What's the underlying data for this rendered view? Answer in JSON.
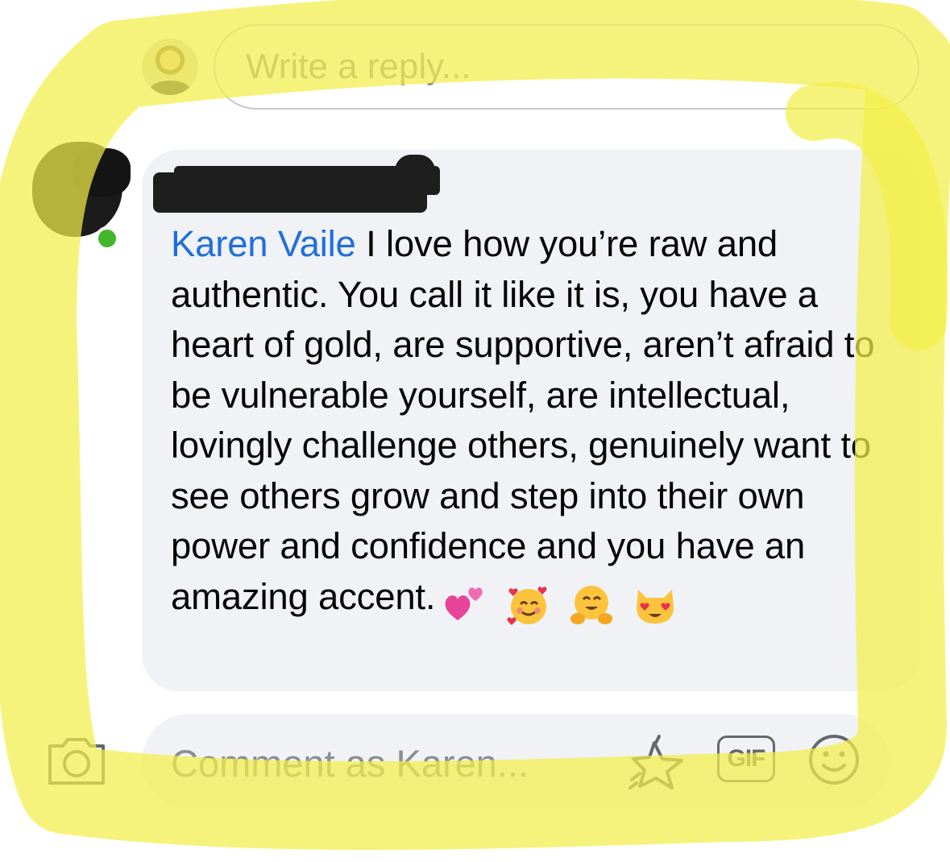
{
  "reply_box": {
    "placeholder": "Write a reply..."
  },
  "comment": {
    "author_name": "",
    "mention": "Karen Vaile",
    "text": " I love how you’re raw and authentic.  You call it like it is, you have a heart of gold, are supportive, aren’t afraid to be vulnerable yourself, are intellectual, lovingly challenge others, genuinely want to see others grow and step into their own power and confidence and you have an amazing accent.",
    "emojis": [
      "two-hearts",
      "smiling-face-with-hearts",
      "hugging-face",
      "heart-eyes-cat"
    ],
    "online_status_color": "#42b72a"
  },
  "composer": {
    "placeholder": "Comment as Karen...",
    "gif_label": "GIF",
    "icons": [
      "camera-icon",
      "avatar-sticker-icon",
      "gif-icon",
      "emoji-icon"
    ]
  },
  "colors": {
    "mention": "#216fdb",
    "bubble": "#f0f2f5",
    "highlight": "#f2ef4a"
  }
}
